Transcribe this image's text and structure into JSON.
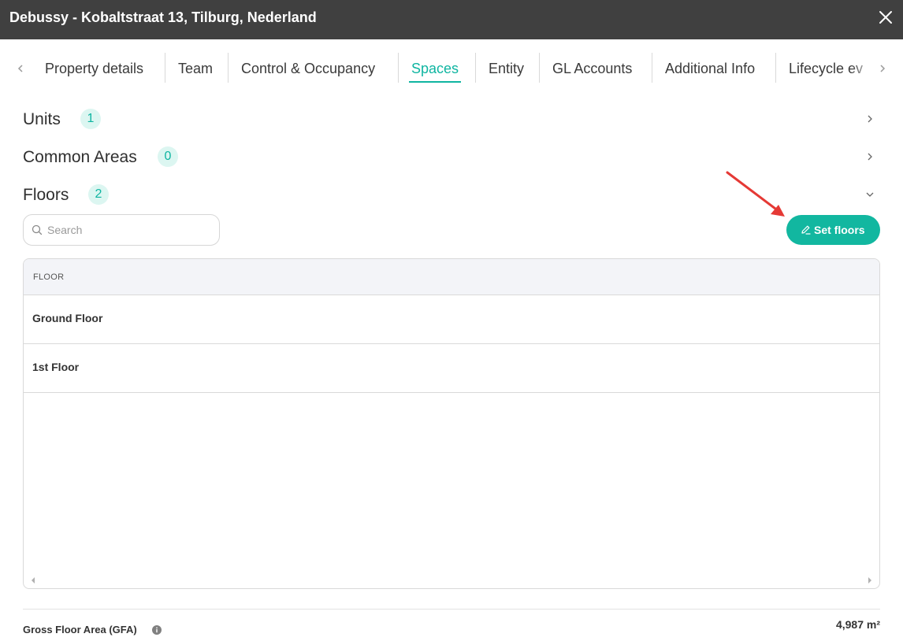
{
  "window": {
    "title": "Debussy - Kobaltstraat 13, Tilburg, Nederland"
  },
  "tabs": [
    {
      "label": "Property details"
    },
    {
      "label": "Team"
    },
    {
      "label": "Control & Occupancy"
    },
    {
      "label": "Spaces",
      "active": true
    },
    {
      "label": "Entity"
    },
    {
      "label": "GL Accounts"
    },
    {
      "label": "Additional Info"
    },
    {
      "label": "Lifecycle ev"
    }
  ],
  "sections": {
    "units": {
      "label": "Units",
      "count": "1",
      "state": "collapsed"
    },
    "common_areas": {
      "label": "Common Areas",
      "count": "0",
      "state": "collapsed"
    },
    "floors": {
      "label": "Floors",
      "count": "2",
      "state": "expanded"
    }
  },
  "search": {
    "placeholder": "Search",
    "value": ""
  },
  "set_floors_button": {
    "label": "Set floors"
  },
  "floors_table": {
    "columns": [
      "FLOOR"
    ],
    "rows": [
      {
        "floor": "Ground Floor"
      },
      {
        "floor": "1st Floor"
      }
    ]
  },
  "gfa": {
    "label": "Gross Floor Area (GFA)",
    "value": "4,987 m²"
  },
  "colors": {
    "accent": "#12b7a0",
    "titlebar": "#404040",
    "annotation_arrow": "#e53935"
  }
}
